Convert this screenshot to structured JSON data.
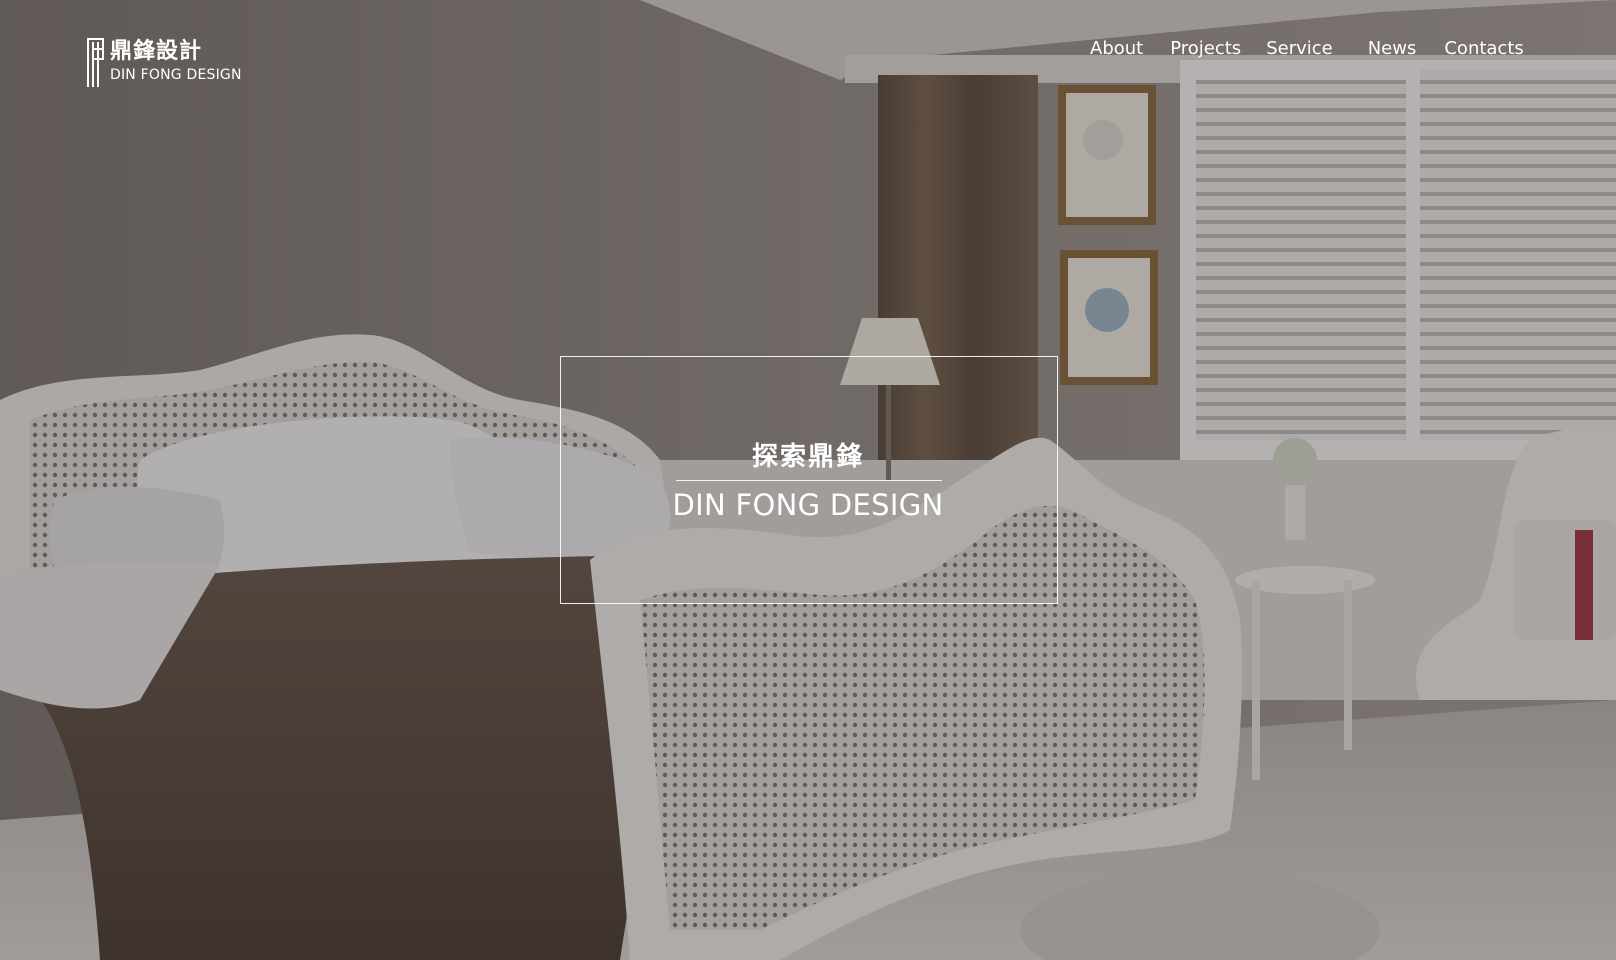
{
  "logo": {
    "chinese": "鼎鋒設計",
    "english": "DIN FONG DESIGN"
  },
  "nav": {
    "about": "About",
    "projects": "Projects",
    "service": "Service",
    "news": "News",
    "contacts": "Contacts"
  },
  "hero": {
    "title_cn": "探索鼎鋒",
    "title_en": "DIN FONG DESIGN"
  },
  "colors": {
    "text": "#ffffff",
    "wall": "#8d8580",
    "bedspread": "#5a4a42",
    "curtain": "#6b5a4a"
  }
}
